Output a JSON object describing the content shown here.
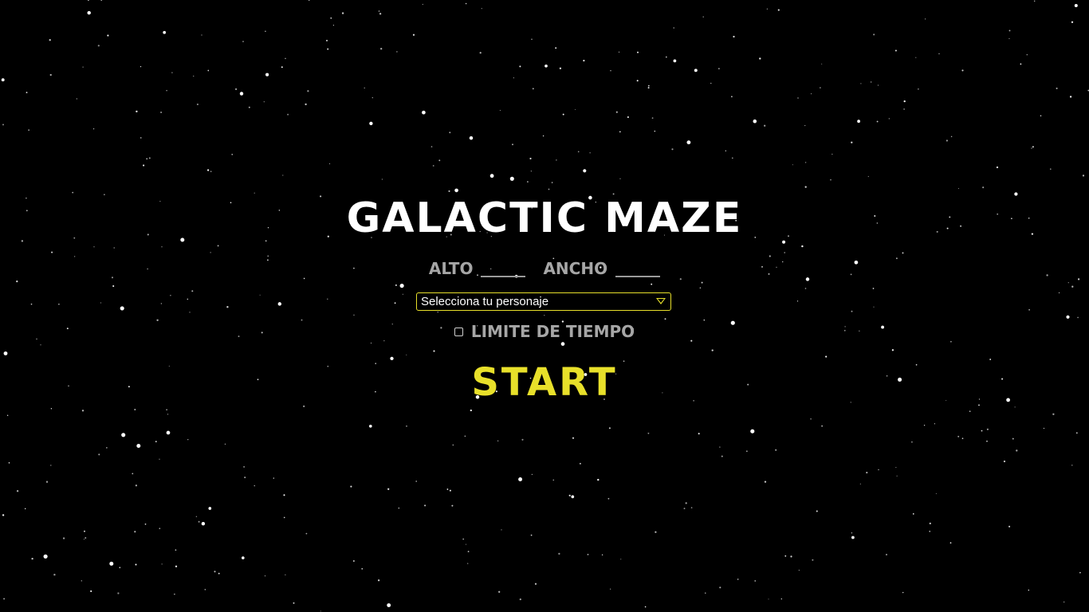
{
  "game": {
    "title": "GALACTIC MAZE"
  },
  "settings": {
    "alto_label": "ALTO",
    "alto_value": "",
    "ancho_label": "ANCHO",
    "ancho_value": "",
    "character_select": {
      "selected": "Selecciona tu personaje"
    },
    "time_limit": {
      "label": "LIMITE DE TIEMPO",
      "checked": false
    }
  },
  "actions": {
    "start_label": "START"
  },
  "colors": {
    "background": "#000000",
    "title": "#ffffff",
    "labels": "#a6a6a6",
    "accent": "#e8e02a"
  }
}
